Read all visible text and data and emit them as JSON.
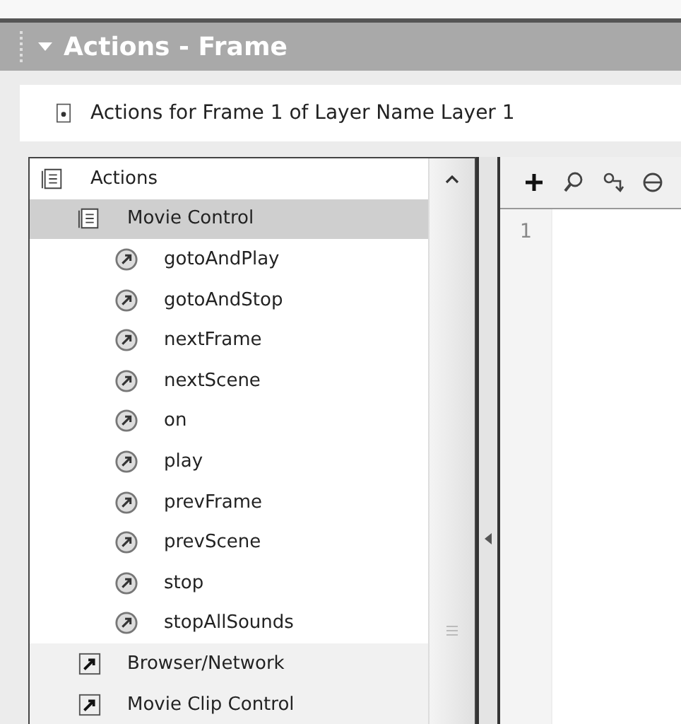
{
  "panel": {
    "title": "Actions - Frame",
    "expanded": true
  },
  "info_bar": {
    "text": "Actions for Frame 1 of Layer Name Layer 1"
  },
  "actions_tree": [
    {
      "label": "Actions",
      "kind": "category",
      "expanded": true,
      "selected": false,
      "children": [
        {
          "label": "Movie Control",
          "kind": "category",
          "expanded": true,
          "selected": true,
          "children": [
            {
              "label": "gotoAndPlay",
              "kind": "action",
              "selected": false
            },
            {
              "label": "gotoAndStop",
              "kind": "action",
              "selected": false
            },
            {
              "label": "nextFrame",
              "kind": "action",
              "selected": false
            },
            {
              "label": "nextScene",
              "kind": "action",
              "selected": false
            },
            {
              "label": "on",
              "kind": "action",
              "selected": false
            },
            {
              "label": "play",
              "kind": "action",
              "selected": false
            },
            {
              "label": "prevFrame",
              "kind": "action",
              "selected": false
            },
            {
              "label": "prevScene",
              "kind": "action",
              "selected": false
            },
            {
              "label": "stop",
              "kind": "action",
              "selected": false
            },
            {
              "label": "stopAllSounds",
              "kind": "action",
              "selected": false
            }
          ]
        },
        {
          "label": "Browser/Network",
          "kind": "category",
          "expanded": false,
          "selected": false
        },
        {
          "label": "Movie Clip Control",
          "kind": "category",
          "expanded": false,
          "selected": false
        }
      ]
    }
  ],
  "editor": {
    "line_numbers": [
      "1"
    ]
  }
}
